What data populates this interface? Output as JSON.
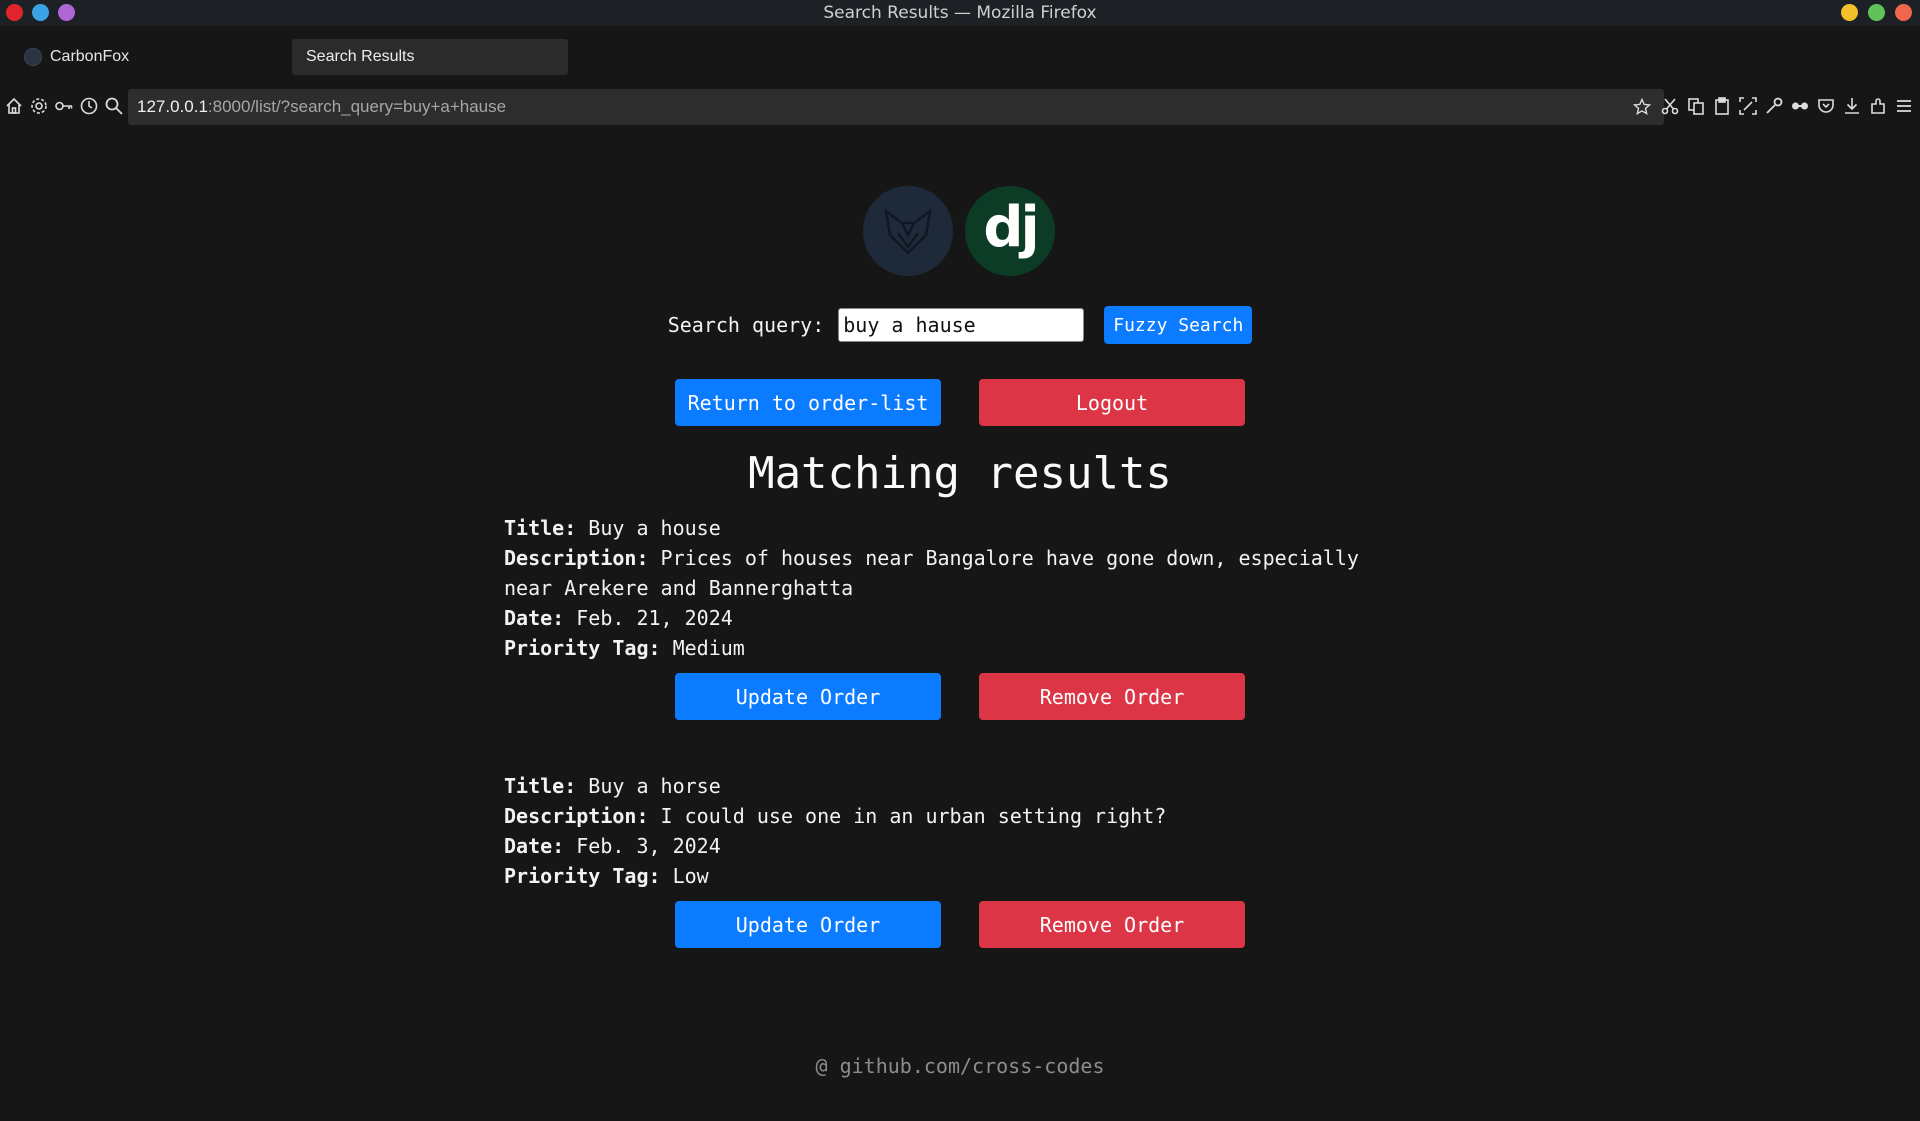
{
  "window": {
    "title": "Search Results — Mozilla Firefox",
    "left_dots": [
      "#e0262c",
      "#3aa3e6",
      "#b067d6"
    ],
    "right_dots": [
      "#f2c029",
      "#5fc35a",
      "#f0674b"
    ]
  },
  "tabs": [
    {
      "label": "CarbonFox",
      "active": false
    },
    {
      "label": "Search Results",
      "active": true
    }
  ],
  "nav": {
    "url_host": "127.0.0.1",
    "url_rest": ":8000/list/?search_query=buy+a+hause",
    "left_icons": [
      "home-icon",
      "gear-icon",
      "key-icon",
      "history-icon",
      "search-icon"
    ],
    "right_icons": [
      "cut-icon",
      "copy-icon",
      "paste-icon",
      "screenshot-icon",
      "tools-icon",
      "private-browsing-icon",
      "pocket-icon",
      "downloads-icon",
      "extensions-icon",
      "menu-icon"
    ]
  },
  "page": {
    "logos": [
      "fox-logo",
      "django-logo"
    ],
    "django_text": "dj",
    "search_label": "Search query:",
    "search_value": "buy a hause",
    "fuzzy_button": "Fuzzy Search",
    "return_button": "Return to order-list",
    "logout_button": "Logout",
    "heading": "Matching results",
    "field_labels": {
      "title": "Title:",
      "description": "Description:",
      "date": "Date:",
      "priority": "Priority Tag:"
    },
    "results": [
      {
        "title": "Buy a house",
        "description_line1": "Prices of houses near Bangalore have gone down, especially",
        "description_line2": "near Arekere and Bannerghatta",
        "date": "Feb. 21, 2024",
        "priority": "Medium",
        "update_button": "Update Order",
        "remove_button": "Remove Order"
      },
      {
        "title": "Buy a horse",
        "description_line1": "I could use one in an urban setting right?",
        "date": "Feb. 3, 2024",
        "priority": "Low",
        "update_button": "Update Order",
        "remove_button": "Remove Order"
      }
    ],
    "footer": "@ github.com/cross-codes"
  },
  "colors": {
    "primary": "#0b7bff",
    "danger": "#dc3545",
    "background": "#161616"
  }
}
